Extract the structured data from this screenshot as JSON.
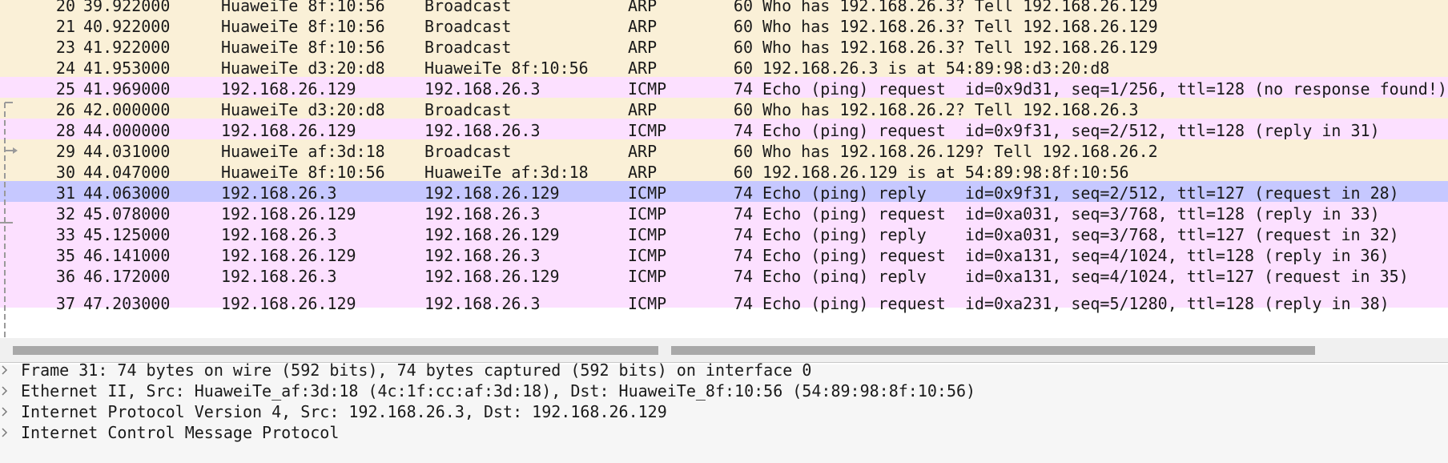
{
  "packet_list": {
    "rows": [
      {
        "no": "20",
        "time": "39.922000",
        "src": "HuaweiTe_8f:10:56",
        "dst": "Broadcast",
        "proto": "ARP",
        "len": "60",
        "info": "Who has 192.168.26.3? Tell 192.168.26.129",
        "kind": "arp"
      },
      {
        "no": "21",
        "time": "40.922000",
        "src": "HuaweiTe_8f:10:56",
        "dst": "Broadcast",
        "proto": "ARP",
        "len": "60",
        "info": "Who has 192.168.26.3? Tell 192.168.26.129",
        "kind": "arp"
      },
      {
        "no": "23",
        "time": "41.922000",
        "src": "HuaweiTe_8f:10:56",
        "dst": "Broadcast",
        "proto": "ARP",
        "len": "60",
        "info": "Who has 192.168.26.3? Tell 192.168.26.129",
        "kind": "arp"
      },
      {
        "no": "24",
        "time": "41.953000",
        "src": "HuaweiTe_d3:20:d8",
        "dst": "HuaweiTe_8f:10:56",
        "proto": "ARP",
        "len": "60",
        "info": "192.168.26.3 is at 54:89:98:d3:20:d8",
        "kind": "arp"
      },
      {
        "no": "25",
        "time": "41.969000",
        "src": "192.168.26.129",
        "dst": "192.168.26.3",
        "proto": "ICMP",
        "len": "74",
        "info": "Echo (ping) request  id=0x9d31, seq=1/256, ttl=128 (no response found!)",
        "kind": "icmp"
      },
      {
        "no": "26",
        "time": "42.000000",
        "src": "HuaweiTe_d3:20:d8",
        "dst": "Broadcast",
        "proto": "ARP",
        "len": "60",
        "info": "Who has 192.168.26.2? Tell 192.168.26.3",
        "kind": "arp"
      },
      {
        "no": "28",
        "time": "44.000000",
        "src": "192.168.26.129",
        "dst": "192.168.26.3",
        "proto": "ICMP",
        "len": "74",
        "info": "Echo (ping) request  id=0x9f31, seq=2/512, ttl=128 (reply in 31)",
        "kind": "icmp"
      },
      {
        "no": "29",
        "time": "44.031000",
        "src": "HuaweiTe_af:3d:18",
        "dst": "Broadcast",
        "proto": "ARP",
        "len": "60",
        "info": "Who has 192.168.26.129? Tell 192.168.26.2",
        "kind": "arp"
      },
      {
        "no": "30",
        "time": "44.047000",
        "src": "HuaweiTe_8f:10:56",
        "dst": "HuaweiTe_af:3d:18",
        "proto": "ARP",
        "len": "60",
        "info": "192.168.26.129 is at 54:89:98:8f:10:56",
        "kind": "arp"
      },
      {
        "no": "31",
        "time": "44.063000",
        "src": "192.168.26.3",
        "dst": "192.168.26.129",
        "proto": "ICMP",
        "len": "74",
        "info": "Echo (ping) reply    id=0x9f31, seq=2/512, ttl=127 (request in 28)",
        "kind": "selected"
      },
      {
        "no": "32",
        "time": "45.078000",
        "src": "192.168.26.129",
        "dst": "192.168.26.3",
        "proto": "ICMP",
        "len": "74",
        "info": "Echo (ping) request  id=0xa031, seq=3/768, ttl=128 (reply in 33)",
        "kind": "icmp"
      },
      {
        "no": "33",
        "time": "45.125000",
        "src": "192.168.26.3",
        "dst": "192.168.26.129",
        "proto": "ICMP",
        "len": "74",
        "info": "Echo (ping) reply    id=0xa031, seq=3/768, ttl=127 (request in 32)",
        "kind": "icmp"
      },
      {
        "no": "35",
        "time": "46.141000",
        "src": "192.168.26.129",
        "dst": "192.168.26.3",
        "proto": "ICMP",
        "len": "74",
        "info": "Echo (ping) request  id=0xa131, seq=4/1024, ttl=128 (reply in 36)",
        "kind": "icmp"
      },
      {
        "no": "36",
        "time": "46.172000",
        "src": "192.168.26.3",
        "dst": "192.168.26.129",
        "proto": "ICMP",
        "len": "74",
        "info": "Echo (ping) reply    id=0xa131, seq=4/1024, ttl=127 (request in 35)",
        "kind": "icmp"
      },
      {
        "no": "37",
        "time": "47.203000",
        "src": "192.168.26.129",
        "dst": "192.168.26.3",
        "proto": "ICMP",
        "len": "74",
        "info": "Echo (ping) request  id=0xa231, seq=5/1280, ttl=128 (reply in 38)",
        "kind": "icmp"
      }
    ]
  },
  "details": {
    "items": [
      {
        "text": "Frame 31: 74 bytes on wire (592 bits), 74 bytes captured (592 bits) on interface 0"
      },
      {
        "text": "Ethernet II, Src: HuaweiTe_af:3d:18 (4c:1f:cc:af:3d:18), Dst: HuaweiTe_8f:10:56 (54:89:98:8f:10:56)"
      },
      {
        "text": "Internet Protocol Version 4, Src: 192.168.26.3, Dst: 192.168.26.129"
      },
      {
        "text": "Internet Control Message Protocol"
      }
    ]
  },
  "colors": {
    "arp_row": "#faf0d7",
    "icmp_row": "#fce0ff",
    "selected_row": "#c6c8ff",
    "details_bg": "#f6f6f6"
  },
  "icons": {
    "expand": "chevron-right-icon"
  }
}
